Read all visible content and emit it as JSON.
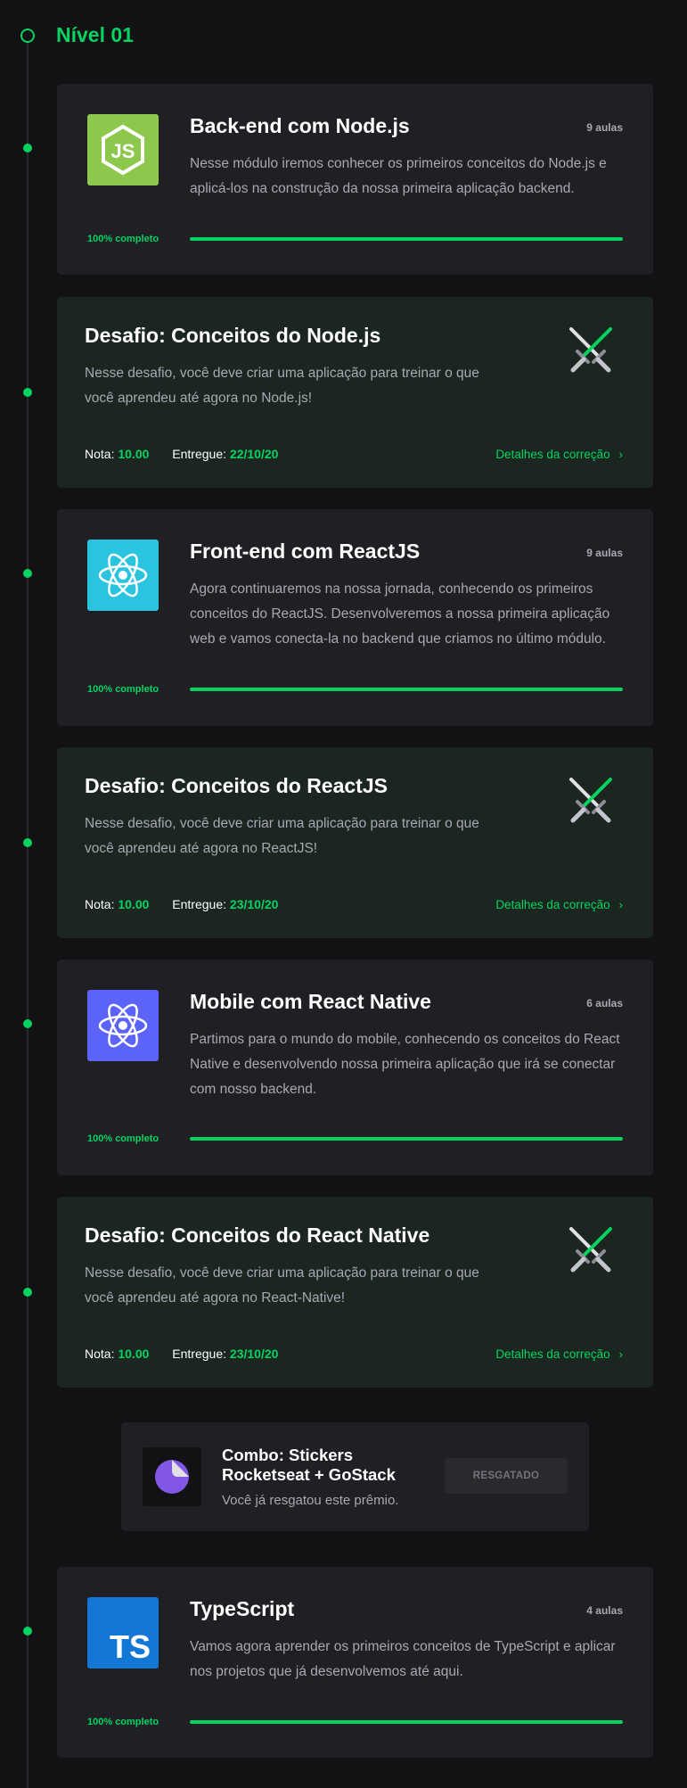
{
  "level": {
    "title": "Nível 01"
  },
  "modules": [
    {
      "title": "Back-end com Node.js",
      "lessons": "9 aulas",
      "description": "Nesse módulo iremos conhecer os primeiros conceitos do Node.js e aplicá-los na construção da nossa primeira aplicação backend.",
      "progress_label": "100% completo",
      "progress": 1.0,
      "icon": "nodejs-icon",
      "icon_text": "JS",
      "color": "#8cc84b"
    },
    {
      "title": "Front-end com ReactJS",
      "lessons": "9 aulas",
      "description": "Agora continuaremos na nossa jornada, conhecendo os primeiros conceitos do ReactJS. Desenvolveremos a nossa primeira aplicação web e vamos conecta-la no backend que criamos no último módulo.",
      "progress_label": "100% completo",
      "progress": 1.0,
      "icon": "react-icon",
      "color": "#2bc4e0"
    },
    {
      "title": "Mobile com React Native",
      "lessons": "6 aulas",
      "description": "Partimos para o mundo do mobile, conhecendo os conceitos do React Native e desenvolvendo nossa primeira aplicação que irá se conectar com nosso backend.",
      "progress_label": "100% completo",
      "progress": 1.0,
      "icon": "react-native-icon",
      "color": "#5b63f8"
    },
    {
      "title": "TypeScript",
      "lessons": "4 aulas",
      "description": "Vamos agora aprender os primeiros conceitos de TypeScript e aplicar nos projetos que já desenvolvemos até aqui.",
      "progress_label": "100% completo",
      "progress": 1.0,
      "icon": "typescript-icon",
      "icon_text": "TS",
      "color": "#1277d5"
    }
  ],
  "challenges": [
    {
      "title": "Desafio: Conceitos do Node.js",
      "description": "Nesse desafio, você deve criar uma aplicação para treinar o que você aprendeu até agora no Node.js!",
      "grade_label": "Nota:",
      "grade": "10.00",
      "delivered_label": "Entregue:",
      "delivered": "22/10/20",
      "link": "Detalhes da correção",
      "icon": "crossed-swords-icon"
    },
    {
      "title": "Desafio: Conceitos do ReactJS",
      "description": "Nesse desafio, você deve criar uma aplicação para treinar o que você aprendeu até agora no ReactJS!",
      "grade_label": "Nota:",
      "grade": "10.00",
      "delivered_label": "Entregue:",
      "delivered": "23/10/20",
      "link": "Detalhes da correção",
      "icon": "crossed-swords-icon"
    },
    {
      "title": "Desafio: Conceitos do React Native",
      "description": "Nesse desafio, você deve criar uma aplicação para treinar o que você aprendeu até agora no React-Native!",
      "grade_label": "Nota:",
      "grade": "10.00",
      "delivered_label": "Entregue:",
      "delivered": "23/10/20",
      "link": "Detalhes da correção",
      "icon": "crossed-swords-icon"
    }
  ],
  "reward": {
    "title": "Combo: Stickers Rocketseat + GoStack",
    "subtitle": "Você já resgatou este prêmio.",
    "button": "RESGATADO",
    "icon": "sticker-icon"
  },
  "colors": {
    "accent": "#04d361",
    "background": "#121214",
    "card": "#202024",
    "challenge_card": "#1b2620"
  }
}
